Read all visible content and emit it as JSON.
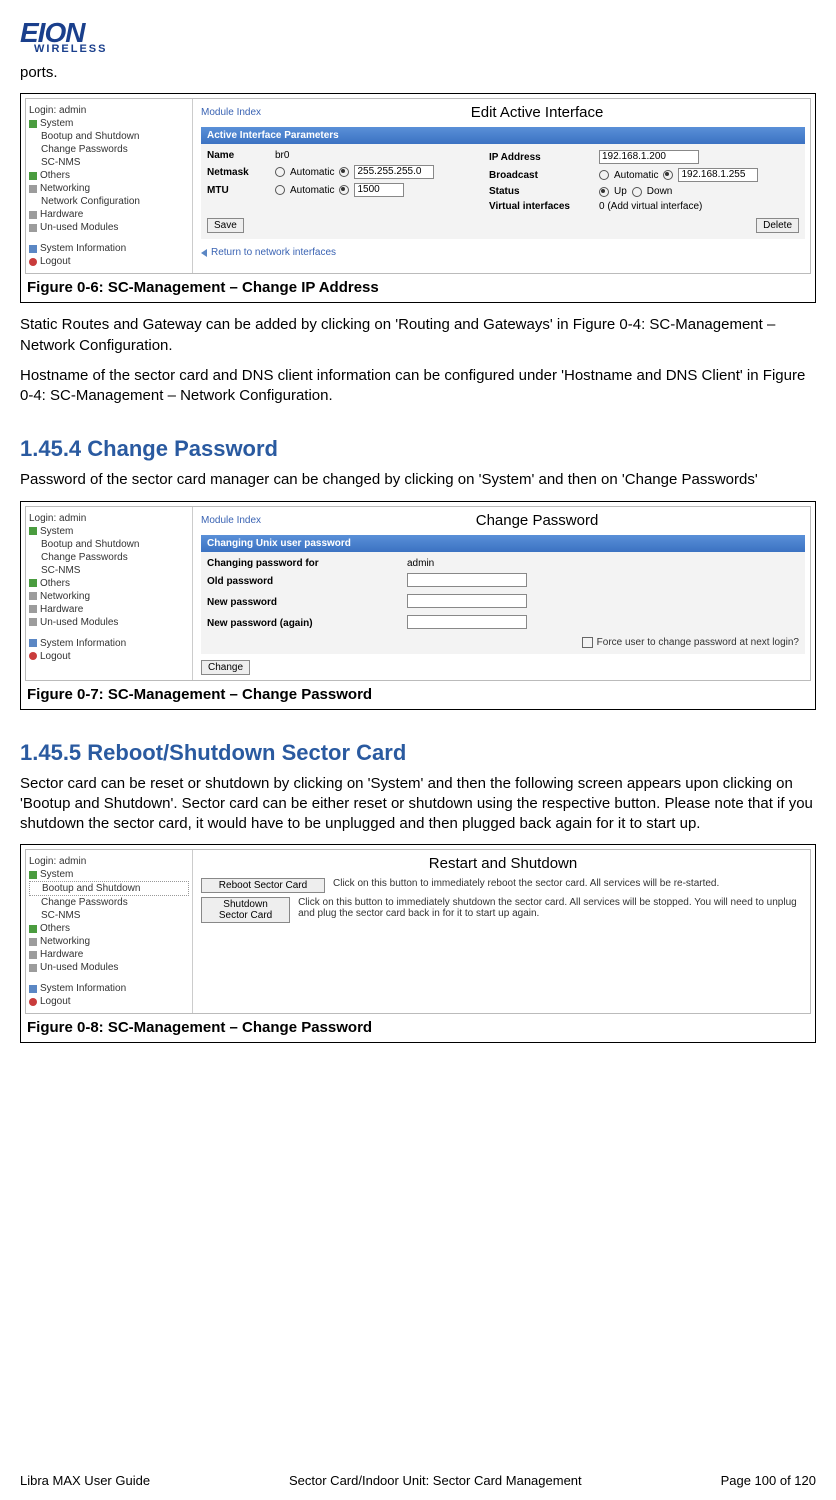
{
  "logo": {
    "main": "EION",
    "sub": "WIRELESS"
  },
  "intro_top": "ports.",
  "figure6": {
    "caption": "Figure 0-6: SC-Management – Change IP Address",
    "nav_login": "Login: admin",
    "nav": {
      "system": "System",
      "bootup": "Bootup and Shutdown",
      "changepw": "Change Passwords",
      "scnms": "SC-NMS",
      "others": "Others",
      "networking": "Networking",
      "netconf": "Network Configuration",
      "hardware": "Hardware",
      "unused": "Un-used Modules",
      "sysinfo": "System Information",
      "logout": "Logout"
    },
    "module_index": "Module Index",
    "title": "Edit Active Interface",
    "panel_title": "Active Interface Parameters",
    "name_l": "Name",
    "name_v": "br0",
    "netmask_l": "Netmask",
    "auto_l": "Automatic",
    "netmask_v": "255.255.255.0",
    "mtu_l": "MTU",
    "mtu_v": "1500",
    "ip_l": "IP Address",
    "ip_v": "192.168.1.200",
    "bcast_l": "Broadcast",
    "bcast_v": "192.168.1.255",
    "status_l": "Status",
    "up_l": "Up",
    "down_l": "Down",
    "virt_l": "Virtual interfaces",
    "virt_v": "0 (Add virtual interface)",
    "save_btn": "Save",
    "delete_btn": "Delete",
    "return": "Return to network interfaces"
  },
  "para1": "Static Routes and Gateway can be added by clicking on 'Routing and Gateways' in Figure 0-4: SC-Management – Network Configuration.",
  "para2": "Hostname of the sector card and DNS client information can be configured under 'Hostname and DNS Client' in Figure 0-4: SC-Management – Network Configuration.",
  "heading1454": "1.45.4 Change Password",
  "para3": "Password of the sector card manager can be changed by clicking on 'System' and then on 'Change Passwords'",
  "figure7": {
    "caption": "Figure 0-7: SC-Management – Change Password",
    "title": "Change Password",
    "panel_title": "Changing Unix user password",
    "l1": "Changing password for",
    "v1": "admin",
    "l2": "Old password",
    "l3": "New password",
    "l4": "New password (again)",
    "force": "Force user to change password at next login?",
    "change_btn": "Change"
  },
  "heading1455": "1.45.5 Reboot/Shutdown Sector Card",
  "para4": "Sector card can be reset or shutdown by clicking on 'System' and then the following screen appears upon clicking on 'Bootup and Shutdown'. Sector card can be either reset or shutdown using the respective button. Please note that if you shutdown the sector card, it would have to be unplugged and then plugged back again for it to start up.",
  "figure8": {
    "caption": "Figure 0-8: SC-Management – Change Password",
    "title": "Restart and Shutdown",
    "reboot_btn": "Reboot Sector Card",
    "reboot_text": "Click on this button to immediately reboot the sector card. All services will be re-started.",
    "shutdown_btn": "Shutdown Sector Card",
    "shutdown_text": "Click on this button to immediately shutdown the sector card. All services will be stopped. You will need to unplug and plug the sector card back in for it to start up again."
  },
  "footer": {
    "left": "Libra MAX User Guide",
    "center": "Sector Card/Indoor Unit: Sector Card Management",
    "right": "Page 100 of 120"
  }
}
